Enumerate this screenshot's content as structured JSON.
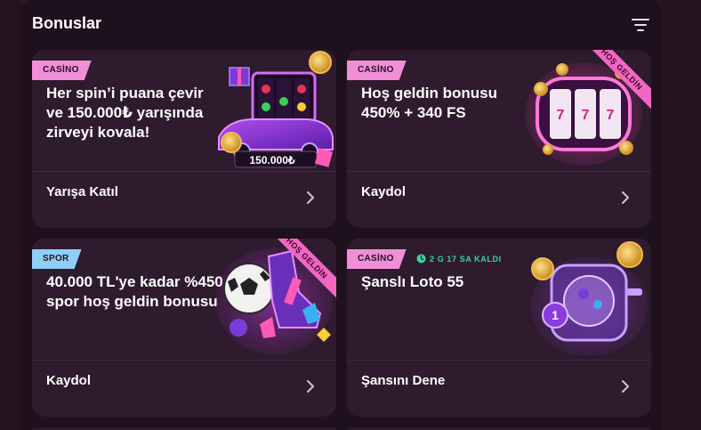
{
  "panel": {
    "title": "Bonuslar"
  },
  "cards": [
    {
      "badge": "CASİNO",
      "title": "Her spin’i puana çevir ve 150.000₺ yarışında zirveyi kovala!",
      "art_label": "150.000₺",
      "action": "Yarışa Katıl"
    },
    {
      "badge": "CASİNO",
      "title": "Hoş geldin bonusu 450% + 340 FS",
      "ribbon": "HOŞ GELDİN",
      "action": "Kaydol"
    },
    {
      "badge": "SPOR",
      "title": "40.000 TL'ye kadar %450 spor hoş geldin bonusu",
      "ribbon": "HOŞ GELDİN",
      "action": "Kaydol"
    },
    {
      "badge": "CASİNO",
      "timer": "2 G 17 SA KALDI",
      "title": "Şanslı Loto 55",
      "action": "Şansını Dene"
    }
  ],
  "colors": {
    "casino_badge": "#f08fd8",
    "spor_badge": "#8ed0f5",
    "timer": "#35d6a0",
    "card_bg": "#2e1b2d",
    "panel_bg": "#1f101d"
  }
}
